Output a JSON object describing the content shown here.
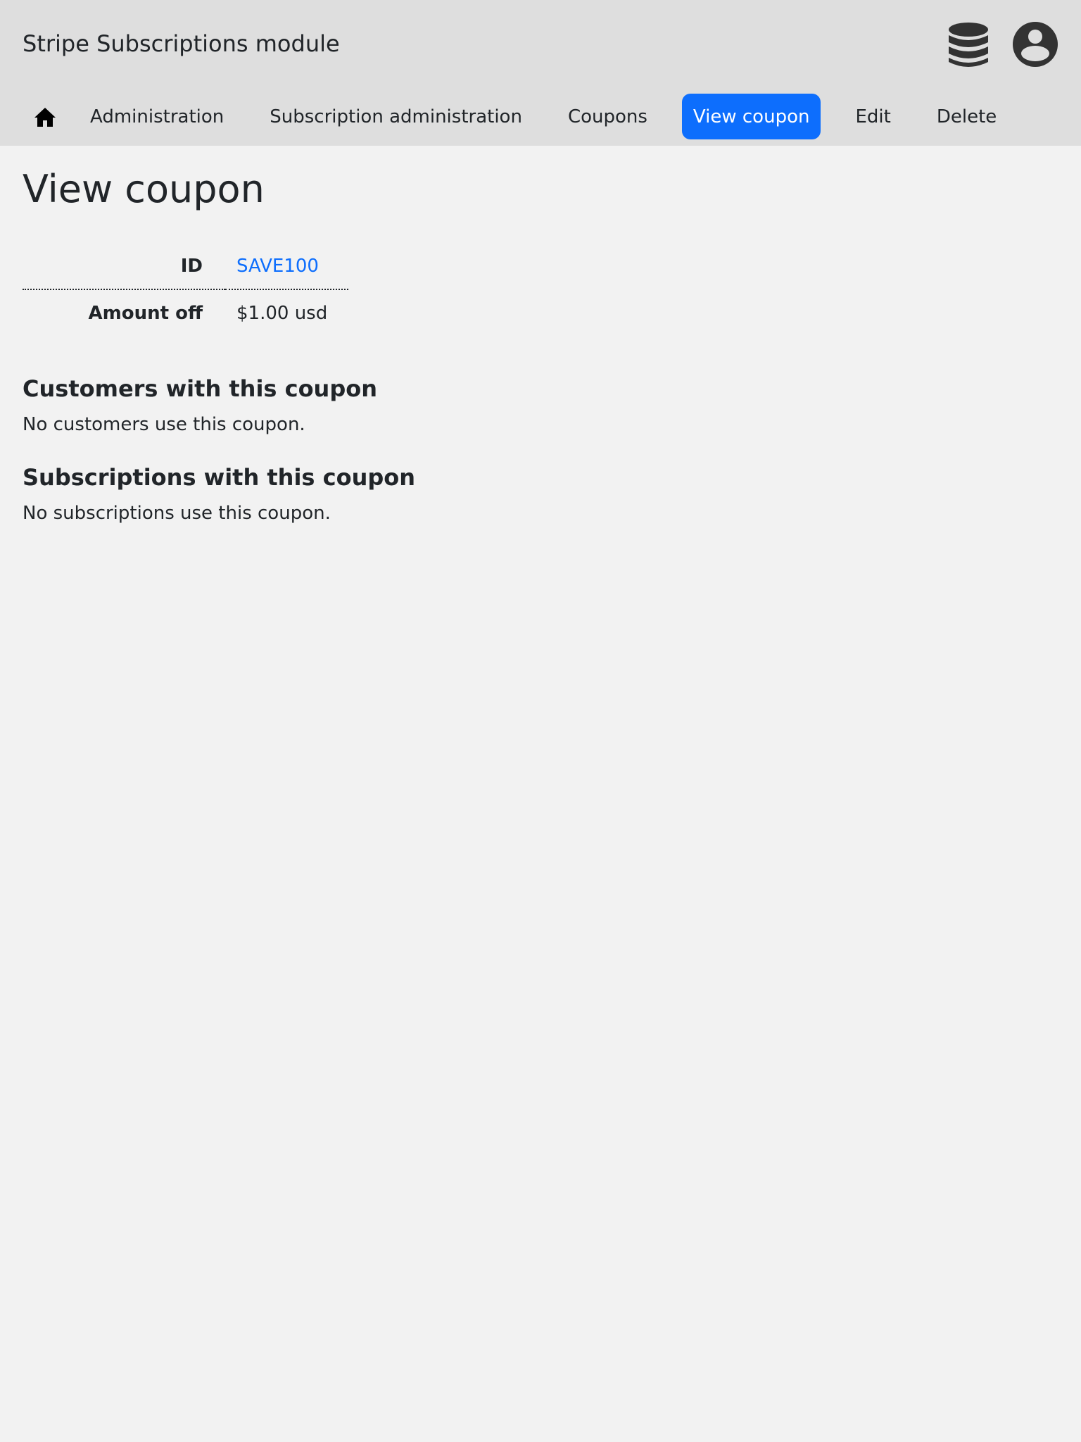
{
  "app": {
    "title": "Stripe Subscriptions module"
  },
  "header_icons": [
    "database-icon",
    "user-circle-icon"
  ],
  "nav": {
    "home_icon": "home-icon",
    "items": [
      {
        "label": "Administration",
        "active": false
      },
      {
        "label": "Subscription administration",
        "active": false
      },
      {
        "label": "Coupons",
        "active": false
      },
      {
        "label": "View coupon",
        "active": true
      },
      {
        "label": "Edit",
        "active": false
      },
      {
        "label": "Delete",
        "active": false
      }
    ]
  },
  "page": {
    "title": "View coupon"
  },
  "details": {
    "id_label": "ID",
    "id_value": "SAVE100",
    "amount_label": "Amount off",
    "amount_value": "$1.00 usd"
  },
  "customers_section": {
    "heading": "Customers with this coupon",
    "text": "No customers use this coupon."
  },
  "subscriptions_section": {
    "heading": "Subscriptions with this coupon",
    "text": "No subscriptions use this coupon."
  },
  "colors": {
    "header_bg": "#dedede",
    "page_bg": "#f2f2f2",
    "accent": "#0d6efd",
    "text": "#212529",
    "icon": "#333333"
  }
}
